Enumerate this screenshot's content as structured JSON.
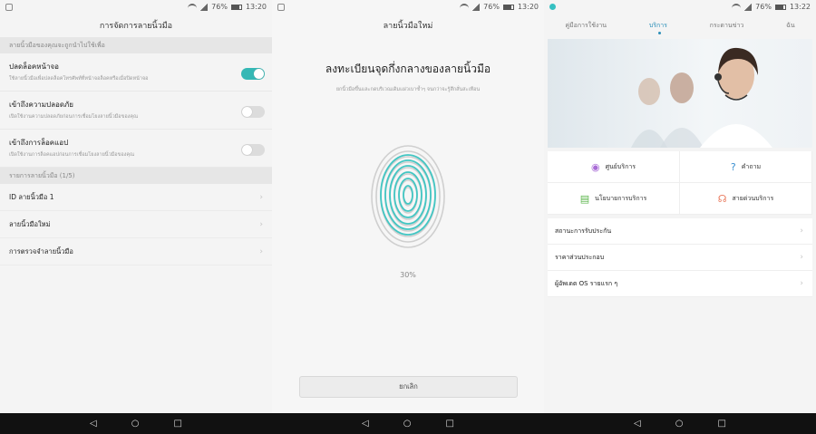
{
  "status": {
    "battery_percent": "76%",
    "times": [
      "13:20",
      "13:20",
      "13:22"
    ]
  },
  "screen1": {
    "title": "การจัดการลายนิ้วมือ",
    "section1_header": "ลายนิ้วมือของคุณจะถูกนำไปใช้เพื่อ",
    "settings": [
      {
        "title": "ปลดล็อคหน้าจอ",
        "desc": "ใช้ลายนิ้วมือเพื่อปลดล็อคโทรศัพท์ที่หน้าจอล็อคหรือเมื่อปิดหน้าจอ",
        "on": true
      },
      {
        "title": "เข้าถึงความปลอดภัย",
        "desc": "เปิดใช้งานความปลอดภัยก่อนการเชื่อมโยงลายนิ้วมือของคุณ",
        "on": false
      },
      {
        "title": "เข้าถึงการล็อคแอป",
        "desc": "เปิดใช้งานการล็อคแอปก่อนการเชื่อมโยงลายนิ้วมือของคุณ",
        "on": false
      }
    ],
    "section2_header": "รายการลายนิ้วมือ (1/5)",
    "nav_items": [
      "ID ลายนิ้วมือ 1",
      "ลายนิ้วมือใหม่",
      "การตรวจจำลายนิ้วมือ"
    ]
  },
  "screen2": {
    "title": "ลายนิ้วมือใหม่",
    "heading": "ลงทะเบียนจุดกึ่งกลางของลายนิ้วมือ",
    "subheading": "ยกนิ้วมือขึ้นและกดบริเวณเดิมแผ่วเบาซ้ำๆ จนกว่าจะรู้สึกสั่นสะเทือน",
    "progress": "30%",
    "progress_fraction": 0.3,
    "cancel_label": "ยกเลิก"
  },
  "screen3": {
    "tabs": [
      "คู่มือการใช้งาน",
      "บริการ",
      "กระดานข่าว",
      "ฉัน"
    ],
    "active_tab": 1,
    "grid": [
      {
        "label": "ศูนย์บริการ",
        "icon": "location-icon",
        "color": "#a86bd6"
      },
      {
        "label": "คำถาม",
        "icon": "question-icon",
        "color": "#3a8fd0"
      },
      {
        "label": "นโยบายการบริการ",
        "icon": "document-icon",
        "color": "#5ab54a"
      },
      {
        "label": "สายด่วนบริการ",
        "icon": "headset-icon",
        "color": "#e9775a"
      }
    ],
    "list": [
      "สถานะการรับประกัน",
      "ราคาส่วนประกอบ",
      "ผู้อัพเดต OS รายแรก ๆ"
    ]
  },
  "colors": {
    "accent": "#35b8b5",
    "tab_active": "#2c8fb8"
  }
}
